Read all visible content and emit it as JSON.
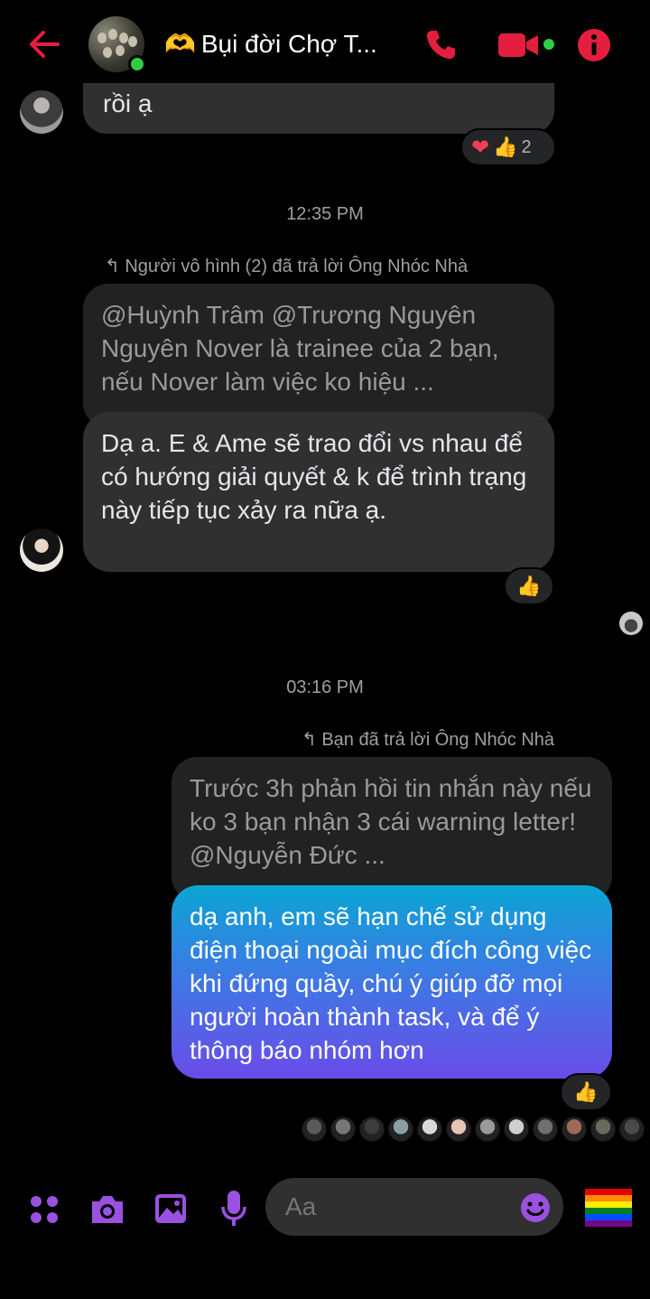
{
  "header": {
    "back_icon": "arrow-left-icon",
    "title_emoji": "🫶",
    "title": "Bụi đời Chợ T...",
    "accent_color": "#e41e3f",
    "online_color": "#31cc46"
  },
  "messages": {
    "top_text": "rồi ạ",
    "top_reactions": {
      "emojis": "❤👍",
      "count": "2"
    },
    "time1": "12:35 PM",
    "reply_note1": "Người vô hình (2) đã trả lời Ông Nhóc Nhà",
    "quoted1": "@Huỳnh Trâm @Trương Nguyên Nguyên Nover là trainee của 2 bạn, nếu Nover làm việc ko hiệu ...",
    "reply1": "Dạ a. E & Ame sẽ trao đổi vs nhau để có hướng giải quyết & k để trình trạng này tiếp tục xảy ra nữa ạ.",
    "reply1_reaction": "👍",
    "time2": "03:16 PM",
    "reply_note2": "Bạn đã trả lời Ông Nhóc Nhà",
    "quoted2": "Trước 3h phản hồi tin nhắn này nếu ko 3 bạn nhận 3 cái warning letter! @Nguyễn Đức ...",
    "reply2": "dạ anh, em sẽ hạn chế sử dụng điện thoại ngoài mục đích công việc khi đứng quầy, chú ý giúp đỡ mọi người hoàn thành task, và để ý thông báo nhóm hơn",
    "reply2_reaction": "👍",
    "my_bubble_gradient": [
      "#0aa6d3",
      "#3b7be4",
      "#6a4ce9"
    ]
  },
  "composer": {
    "placeholder": "Aa",
    "icon_color": "#9b51e0",
    "icons": [
      "apps-icon",
      "camera-icon",
      "gallery-icon",
      "mic-icon",
      "emoji-icon",
      "pride-flag-icon"
    ]
  },
  "seen_count_colors": [
    "#5a5a5a",
    "#777",
    "#3c3c3c",
    "#8aa0a0",
    "#d9d9d9",
    "#e8c4b8",
    "#9a9a9a",
    "#cfcfcf",
    "#707070",
    "#a06a5a",
    "#6a6a5a",
    "#4a4a4a"
  ]
}
